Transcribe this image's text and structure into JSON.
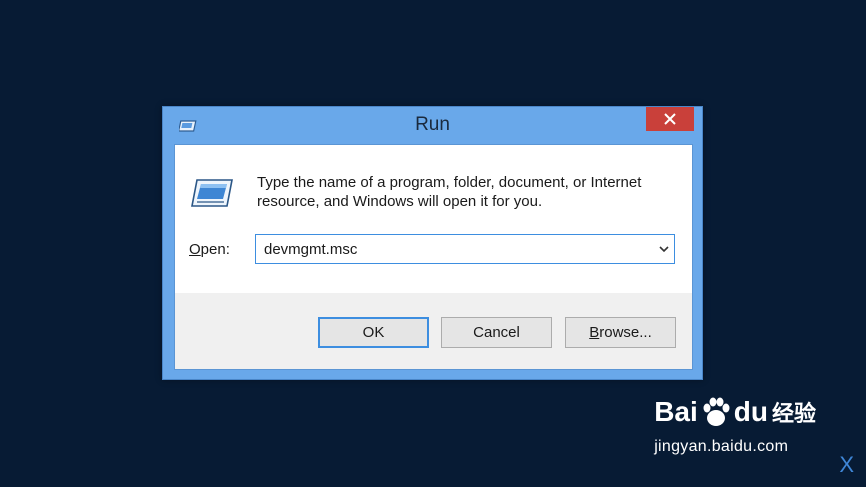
{
  "window": {
    "title": "Run",
    "description": "Type the name of a program, folder, document, or Internet resource, and Windows will open it for you.",
    "open_label_underlined": "O",
    "open_label_rest": "pen:",
    "open_value": "devmgmt.msc",
    "ok_label": "OK",
    "cancel_label": "Cancel",
    "browse_label_underlined": "B",
    "browse_label_rest": "rowse..."
  },
  "watermark": {
    "logo_left": "Bai",
    "logo_right": "du",
    "logo_suffix": "经验",
    "url": "jingyan.baidu.com",
    "corner_letter": "X"
  },
  "colors": {
    "desktop": "#071b34",
    "titlebar": "#69a8ea",
    "close": "#c9403a",
    "focus": "#3d8ee0"
  },
  "icons": [
    "run-icon",
    "close-icon",
    "chevron-down-icon",
    "baidu-paw-icon"
  ]
}
